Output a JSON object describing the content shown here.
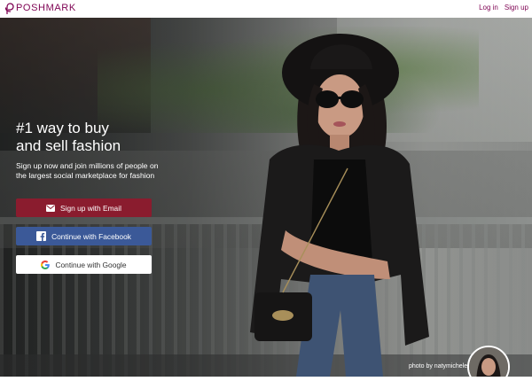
{
  "header": {
    "logo_text": "POSHMARK",
    "login_label": "Log in",
    "signup_label": "Sign up"
  },
  "hero": {
    "title": "#1 way to buy\nand sell fashion",
    "subtitle": "Sign up now and join millions of people on the largest social marketplace for fashion",
    "buttons": {
      "email": "Sign up with Email",
      "facebook": "Continue with Facebook",
      "google": "Continue with Google"
    },
    "photo_credit": "photo by natymichele"
  },
  "colors": {
    "brand": "#7f0353",
    "email_button": "#8a1c2e",
    "facebook_button": "#3b5998",
    "google_button": "#ffffff"
  },
  "icons": [
    "poshmark-logo-icon",
    "email-icon",
    "facebook-icon",
    "google-icon"
  ]
}
